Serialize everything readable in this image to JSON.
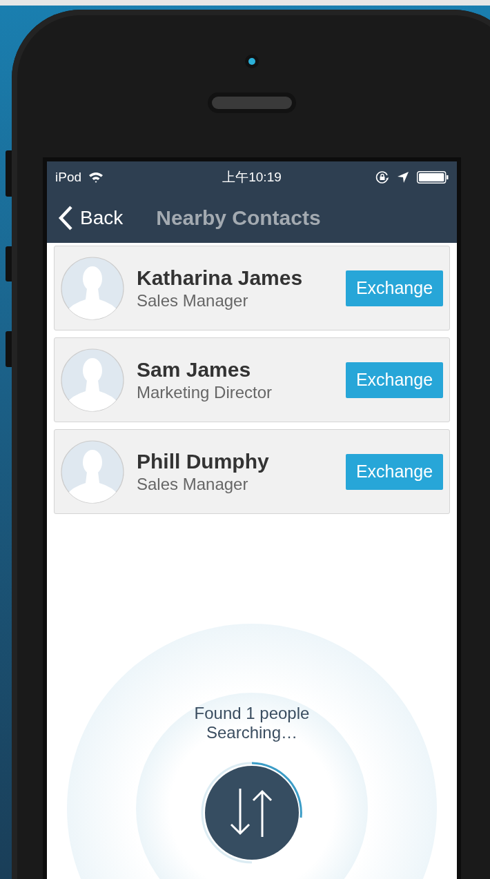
{
  "status_bar": {
    "carrier": "iPod",
    "time": "上午10:19"
  },
  "nav": {
    "back": "Back",
    "title": "Nearby Contacts"
  },
  "contacts": [
    {
      "name": "Katharina James",
      "role": "Sales Manager",
      "action": "Exchange"
    },
    {
      "name": "Sam James",
      "role": "Marketing Director",
      "action": "Exchange"
    },
    {
      "name": "Phill Dumphy",
      "role": "Sales Manager",
      "action": "Exchange"
    }
  ],
  "radar": {
    "found": "Found 1 people",
    "status": "Searching…"
  }
}
